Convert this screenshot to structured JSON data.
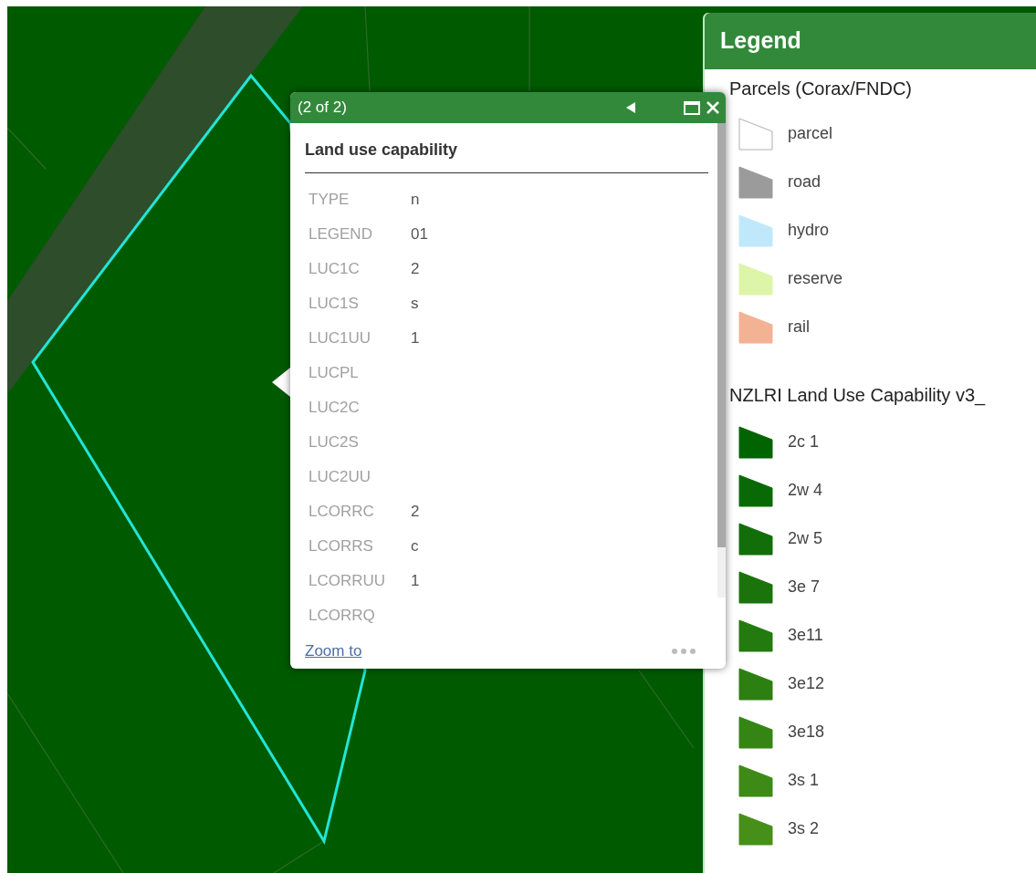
{
  "popup": {
    "counter": "(2 of 2)",
    "title": "Land use capability",
    "fields": [
      {
        "name": "TYPE",
        "value": "n"
      },
      {
        "name": "LEGEND",
        "value": "01"
      },
      {
        "name": "LUC1C",
        "value": "2"
      },
      {
        "name": "LUC1S",
        "value": "s"
      },
      {
        "name": "LUC1UU",
        "value": "1"
      },
      {
        "name": "LUCPL"
      },
      {
        "name": "LUC2C"
      },
      {
        "name": "LUC2S"
      },
      {
        "name": "LUC2UU"
      },
      {
        "name": "LCORRC",
        "value": "2"
      },
      {
        "name": "LCORRS",
        "value": "c"
      },
      {
        "name": "LCORRUU",
        "value": "1"
      },
      {
        "name": "LCORRQ"
      }
    ],
    "link": "Zoom to"
  },
  "legend": {
    "title": "Legend",
    "groups": [
      {
        "title": "Parcels (Corax/FNDC)",
        "items": [
          {
            "label": "parcel",
            "color": "#ffffff"
          },
          {
            "label": "road",
            "color": "#9b9b9b"
          },
          {
            "label": "hydro",
            "color": "#bfe9fb"
          },
          {
            "label": "reserve",
            "color": "#ddf5a8"
          },
          {
            "label": "rail",
            "color": "#f4b294"
          }
        ]
      },
      {
        "title": "NZLRI Land Use Capability v3_",
        "items": [
          {
            "label": "2c 1",
            "color": "#006400"
          },
          {
            "label": "2w 4",
            "color": "#096a05"
          },
          {
            "label": "2w 5",
            "color": "#116e08"
          },
          {
            "label": "3e 7",
            "color": "#1a740b"
          },
          {
            "label": "3e11",
            "color": "#237a0e"
          },
          {
            "label": "3e12",
            "color": "#2c7f11"
          },
          {
            "label": "3e18",
            "color": "#348514"
          },
          {
            "label": "3s 1",
            "color": "#3d8a16"
          },
          {
            "label": "3s 2",
            "color": "#469019"
          }
        ]
      }
    ]
  }
}
